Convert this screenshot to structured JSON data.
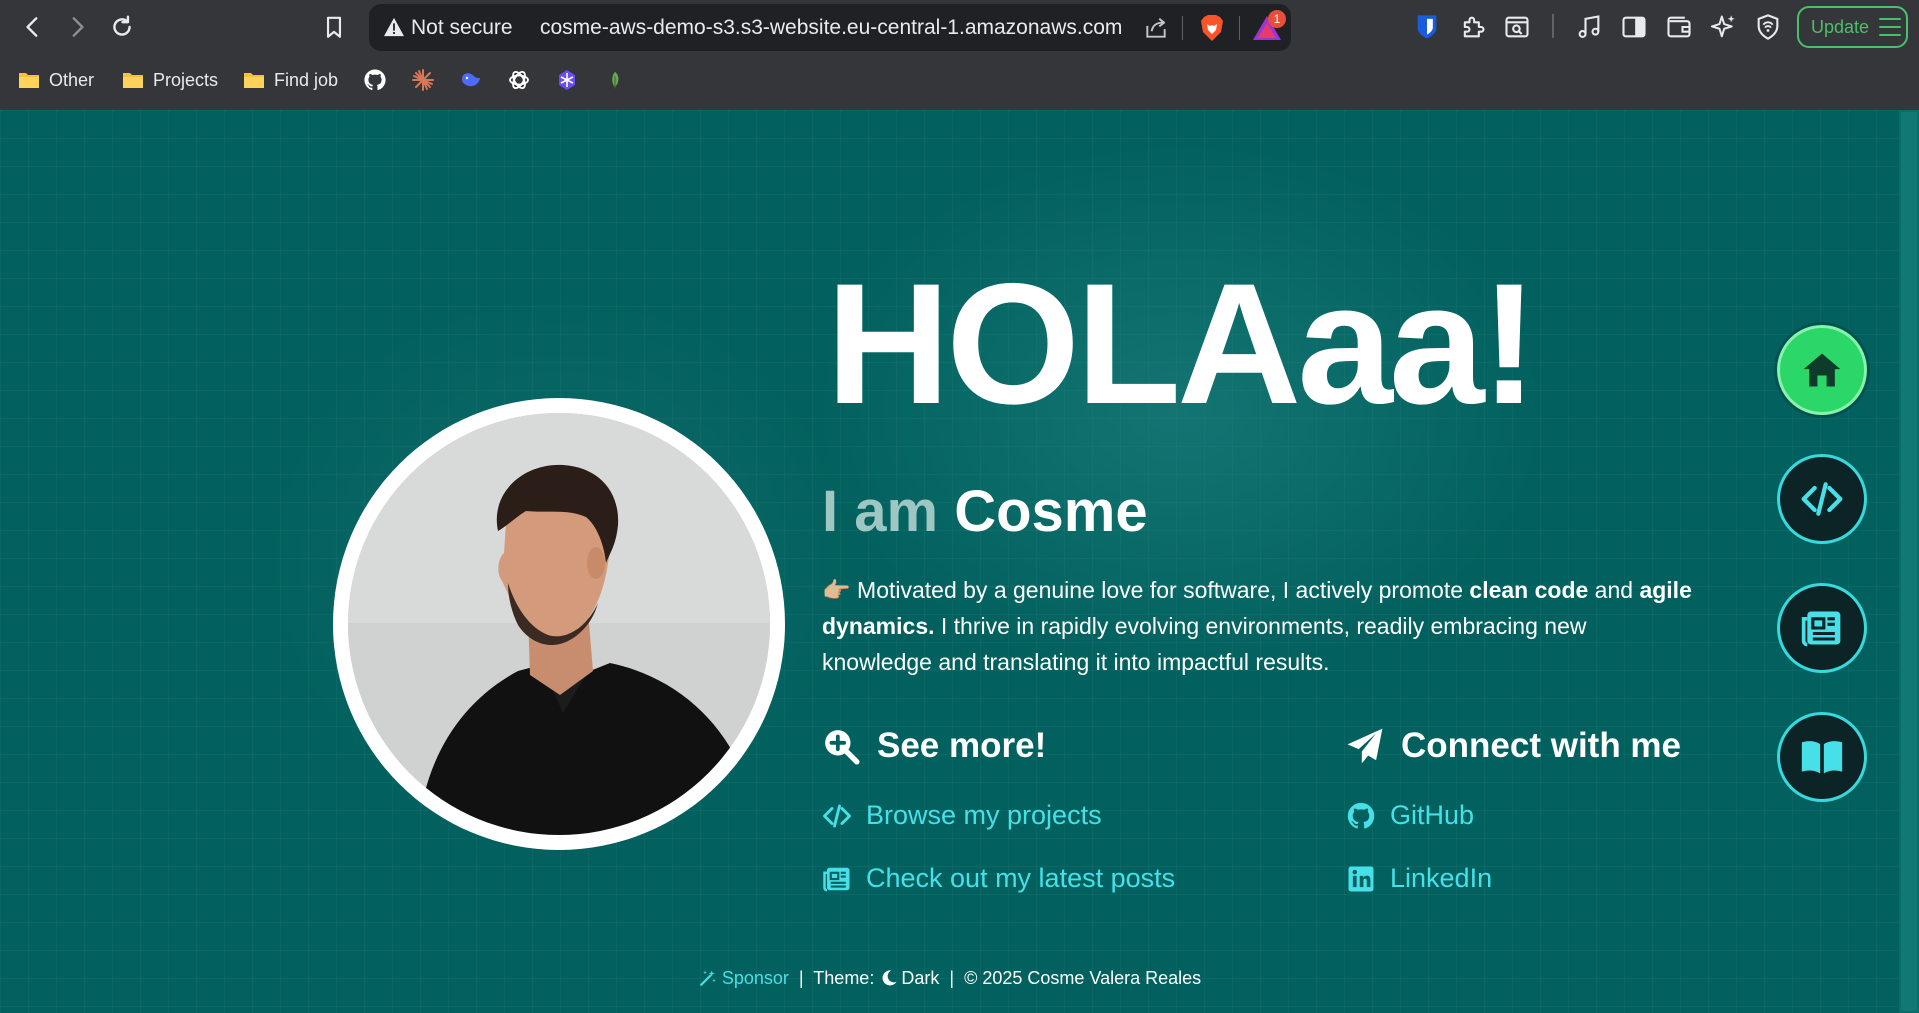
{
  "browser": {
    "omnibox": {
      "security_label": "Not secure",
      "url": "cosme-aws-demo-s3.s3-website.eu-central-1.amazonaws.com",
      "rewards_badge": "1"
    },
    "update_label": "Update",
    "bookmarks": [
      {
        "label": "Other",
        "icon": "folder-icon"
      },
      {
        "label": "Projects",
        "icon": "folder-icon"
      },
      {
        "label": "Find job",
        "icon": "folder-icon"
      }
    ],
    "bookmark_icons": [
      "github-icon",
      "claude-icon",
      "deepseek-icon",
      "chatgpt-icon",
      "perplexity-icon",
      "leaf-icon"
    ]
  },
  "hero": {
    "title": "HOLAaa!",
    "iam_prefix": "I am",
    "name": "Cosme",
    "bio_emoji": "👉🏼",
    "bio_part1": " Motivated by a genuine love for software, I actively promote ",
    "bio_bold1": "clean code",
    "bio_part2": " and ",
    "bio_bold2": "agile dynamics.",
    "bio_part3": " I thrive in rapidly evolving environments, readily embracing new knowledge and translating it into impactful results."
  },
  "see_more": {
    "heading": "See more!",
    "links": [
      {
        "label": "Browse my projects",
        "icon": "code-icon"
      },
      {
        "label": "Check out my latest posts",
        "icon": "newspaper-icon"
      }
    ]
  },
  "connect": {
    "heading": "Connect with me",
    "links": [
      {
        "label": "GitHub",
        "icon": "github-icon"
      },
      {
        "label": "LinkedIn",
        "icon": "linkedin-icon"
      }
    ]
  },
  "side_nav": [
    {
      "name": "home",
      "icon": "home-icon",
      "active": true
    },
    {
      "name": "projects",
      "icon": "code-icon",
      "active": false
    },
    {
      "name": "posts",
      "icon": "newspaper-icon",
      "active": false
    },
    {
      "name": "book",
      "icon": "book-icon",
      "active": false
    }
  ],
  "footer": {
    "sponsor": "Sponsor",
    "separator": "|",
    "theme_label": "Theme:",
    "theme_value": "Dark",
    "copyright": "© 2025 Cosme Valera Reales"
  },
  "colors": {
    "page_background": "#02615e",
    "accent_cyan": "#47e0e8",
    "active_green": "#2cd769",
    "update_green": "#4bbf6b"
  }
}
